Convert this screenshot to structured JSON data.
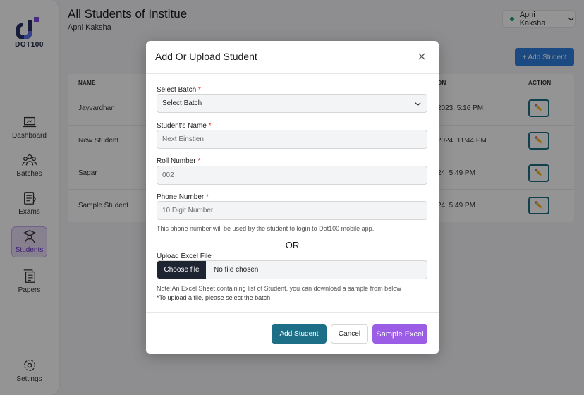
{
  "sidebar": {
    "logo_text": "DOT100",
    "items": [
      {
        "label": "Dashboard",
        "icon": "laptop-icon"
      },
      {
        "label": "Batches",
        "icon": "group-icon"
      },
      {
        "label": "Exams",
        "icon": "exam-icon"
      },
      {
        "label": "Students",
        "icon": "student-icon",
        "active": true
      },
      {
        "label": "Papers",
        "icon": "papers-icon"
      },
      {
        "label": "Settings",
        "icon": "gear-icon"
      }
    ]
  },
  "header": {
    "title": "All Students of Institue",
    "subtitle": "Apni Kaksha",
    "user_name": "Apni Kaksha",
    "add_button": "+ Add Student"
  },
  "table": {
    "columns": [
      "NAME",
      "ON",
      "ACTION"
    ],
    "rows": [
      {
        "name": "Jayvardhan",
        "date": "2023, 5:16 PM"
      },
      {
        "name": "New Student",
        "date": "2024, 11:44 PM"
      },
      {
        "name": "Sagar",
        "date": "24, 5:49 PM"
      },
      {
        "name": "Sample Student",
        "date": "24, 5:49 PM"
      }
    ]
  },
  "modal": {
    "title": "Add Or Upload Student",
    "batch_label": "Select Batch",
    "batch_value": "Select Batch",
    "name_label": "Student's Name",
    "name_placeholder": "Next Einstien",
    "roll_label": "Roll Number",
    "roll_placeholder": "002",
    "phone_label": "Phone Number",
    "phone_placeholder": "10 Digit Number",
    "phone_hint": "This phone number will be used by the student to login to Dot100 mobile app.",
    "or_text": "OR",
    "upload_label": "Upload Excel File",
    "choose_file": "Choose file",
    "no_file": "No file chosen",
    "note1": "Note:An Excel Sheet containing list of Student, you can download a sample from below",
    "note2": "*To upload a file, please select the batch",
    "add_button": "Add Student",
    "cancel_button": "Cancel",
    "sample_button": "Sample Excel",
    "required_mark": "*"
  },
  "colors": {
    "primary_teal": "#1c6f86",
    "purple": "#9b5de5",
    "blue": "#2f7fe0"
  }
}
